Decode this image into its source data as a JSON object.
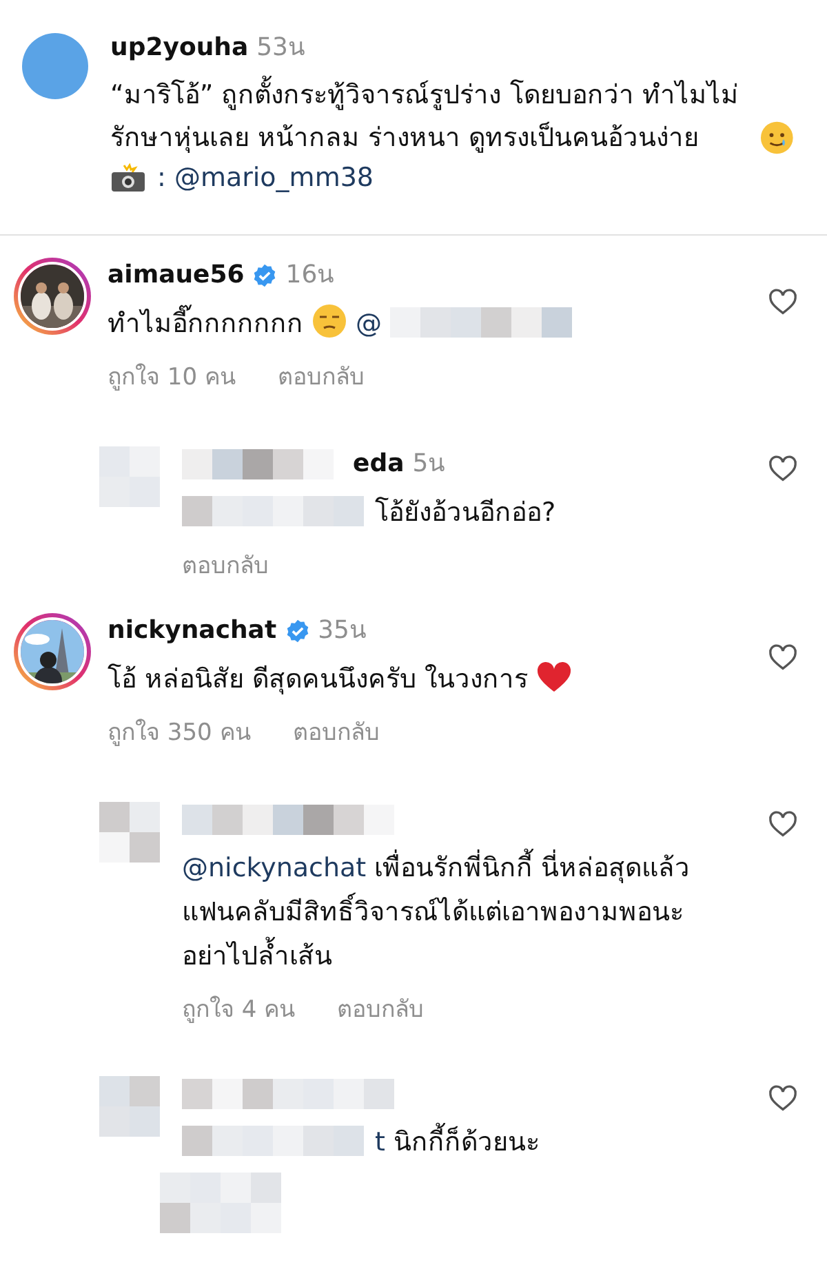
{
  "post": {
    "username": "up2youha",
    "time": "53น",
    "caption": "“มาริโอ้” ถูกตั้งกระทู้วิจารณ์รูปร่าง โดยบอกว่า ทำไมไม่รักษาหุ่นเลย หน้ากลม ร่างหนา ดูทรงเป็นคนอ้วนง่าย",
    "credit": ": @mario_mm38"
  },
  "comments": [
    {
      "kind": "comment",
      "username": "aimaue56",
      "verified": true,
      "time": "16น",
      "parts": [
        {
          "kind": "text",
          "text": "ทำไมอี๊กกกกกกก"
        },
        {
          "kind": "unamused_emoji"
        },
        {
          "kind": "mention",
          "text": "@"
        },
        {
          "kind": "redacted"
        }
      ],
      "likes": "ถูกใจ 10 คน",
      "reply": "ตอบกลับ",
      "redacted": false
    },
    {
      "kind": "reply",
      "username": "eda",
      "time": "5น",
      "parts": [
        {
          "kind": "redacted"
        },
        {
          "kind": "text",
          "text": "โอ้ยังอ้วนอีกอ่อ?"
        }
      ],
      "reply": "ตอบกลับ",
      "redacted": true
    },
    {
      "kind": "comment",
      "username": "nickynachat",
      "verified": true,
      "time": "35น",
      "parts": [
        {
          "kind": "text",
          "text": "โอ้ หล่อนิสัย ดีสุดคนนึงครับ ในวงการ"
        },
        {
          "kind": "heart_emoji"
        }
      ],
      "likes": "ถูกใจ 350 คน",
      "reply": "ตอบกลับ",
      "redacted": false
    },
    {
      "kind": "reply",
      "parts": [
        {
          "kind": "mention",
          "text": "@nickynachat"
        },
        {
          "kind": "text",
          "text": "เพื่อนรักพี่นิกกี้ นี่หล่อสุดแล้ว แฟนคลับมีสิทธิ์วิจารณ์ได้แต่เอาพองามพอนะ อย่าไปล้ำเส้น"
        }
      ],
      "likes": "ถูกใจ 4 คน",
      "reply": "ตอบกลับ",
      "redacted": true
    },
    {
      "kind": "reply",
      "parts": [
        {
          "kind": "redacted"
        },
        {
          "kind": "mention",
          "text": "t"
        },
        {
          "kind": "text",
          "text": "นิกกี้ก็ด้วยนะ"
        },
        {
          "kind": "redacted_block"
        }
      ],
      "redacted": true
    }
  ]
}
